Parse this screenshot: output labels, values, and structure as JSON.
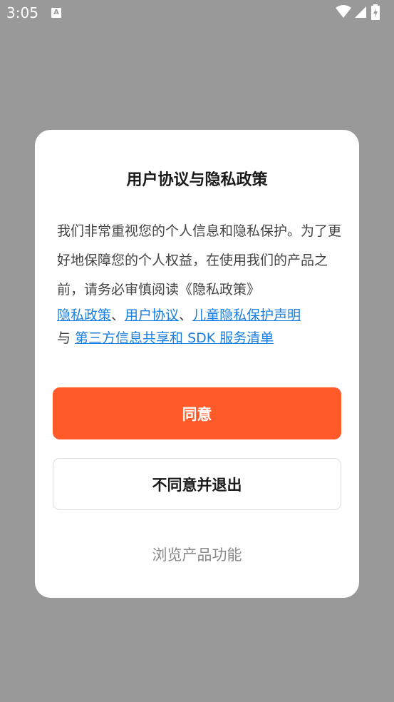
{
  "status_bar": {
    "time": "3:05",
    "notification_icon": "A"
  },
  "dialog": {
    "title": "用户协议与隐私政策",
    "body": "我们非常重视您的个人信息和隐私保护。为了更好地保障您的个人权益，在使用我们的产品之前，请务必审慎阅读《隐私政策》",
    "links": {
      "privacy_policy": "隐私政策",
      "sep1": "、",
      "user_agreement": "用户协议",
      "sep2": "、",
      "children_privacy": "儿童隐私保护声明",
      "conj": "与 ",
      "third_party": "第三方信息共享和 SDK 服务清单"
    },
    "agree_label": "同意",
    "disagree_label": "不同意并退出",
    "browse_label": "浏览产品功能"
  },
  "colors": {
    "accent": "#ff5a28",
    "link": "#1a7fe0",
    "overlay": "#999999"
  }
}
